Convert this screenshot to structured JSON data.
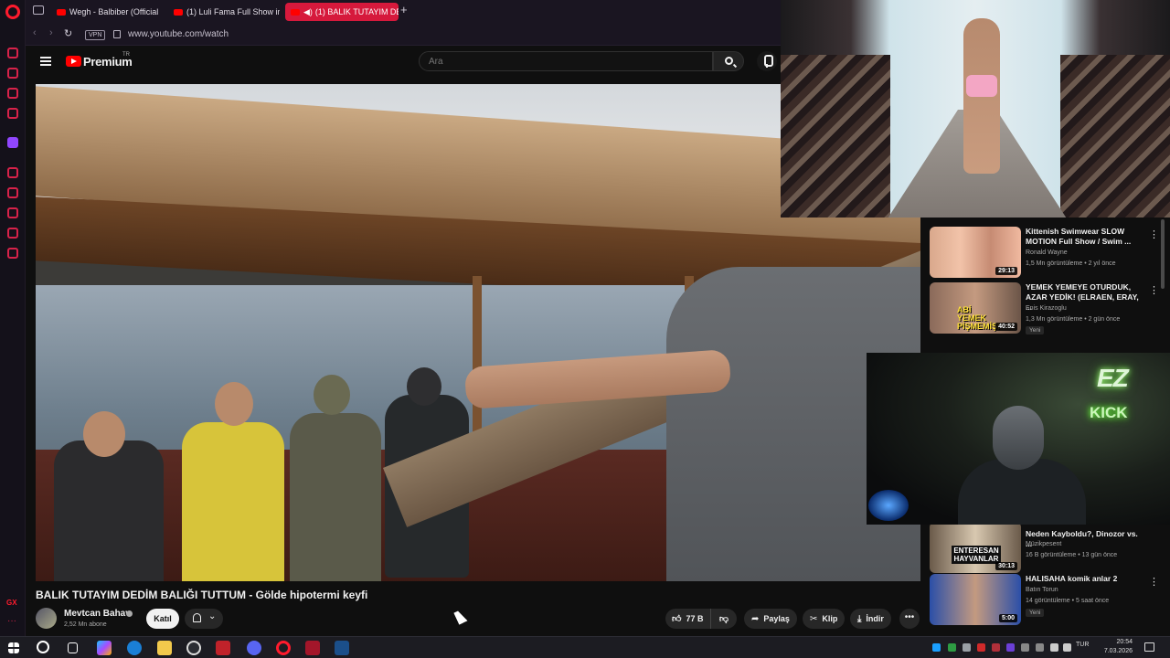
{
  "browser": {
    "tabs": [
      {
        "label": "Wegh - Balbiber (Official L"
      },
      {
        "label": "(1) Luli Fama Full Show in"
      },
      {
        "label": "(1) BALIK TUTAYIM DED"
      }
    ],
    "vpn_label": "VPN",
    "url": "www.youtube.com/watch"
  },
  "youtube": {
    "logo_text": "Premium",
    "region": "TR",
    "search_placeholder": "Ara"
  },
  "video": {
    "title": "BALIK TUTAYIM DEDİM BALIĞI TUTTUM - Gölde hipotermi keyfi",
    "channel": "Mevtcan Bahav",
    "subscribers": "2,52 Mn abone",
    "join_label": "Katıl",
    "likes": "77 B",
    "share_label": "Paylaş",
    "clip_label": "Klip",
    "download_label": "İndir"
  },
  "recommendations": [
    {
      "title": "Kittenish Swimwear SLOW MOTION Full Show / Swim ...",
      "channel": "Ronald Wayne",
      "meta": "1,5 Mn görüntüleme • 2 yıl önce",
      "duration": "29:13",
      "badge": ""
    },
    {
      "title": "YEMEK YEMEYE OTURDUK, AZAR YEDİK! (ELRAEN, ERAY, ...",
      "channel": "Enis Kirazoglu",
      "meta": "1,3 Mn görüntüleme • 2 gün önce",
      "duration": "40:52",
      "badge": "Yeni",
      "thumb_text": "ABİ YEMEK PİŞMEMİŞ!"
    },
    {
      "title": "Neden Kayboldu?, Dinozor vs. ...",
      "channel": "Müzikpesent",
      "meta": "16 B görüntüleme • 13 gün önce",
      "duration": "30:13",
      "badge": "",
      "thumb_text": "ENTERESAN HAYVANLAR"
    },
    {
      "title": "HALISAHA komik anlar 2",
      "channel": "Batın Torun",
      "meta": "14 görüntüleme • 5 saat önce",
      "duration": "5:00",
      "badge": "Yeni"
    }
  ],
  "webcam": {
    "sign_top": "EZ",
    "sign_bottom": "KICK"
  },
  "taskbar": {
    "language": "TUR",
    "time": "20:54",
    "date": "7.03.2026"
  }
}
